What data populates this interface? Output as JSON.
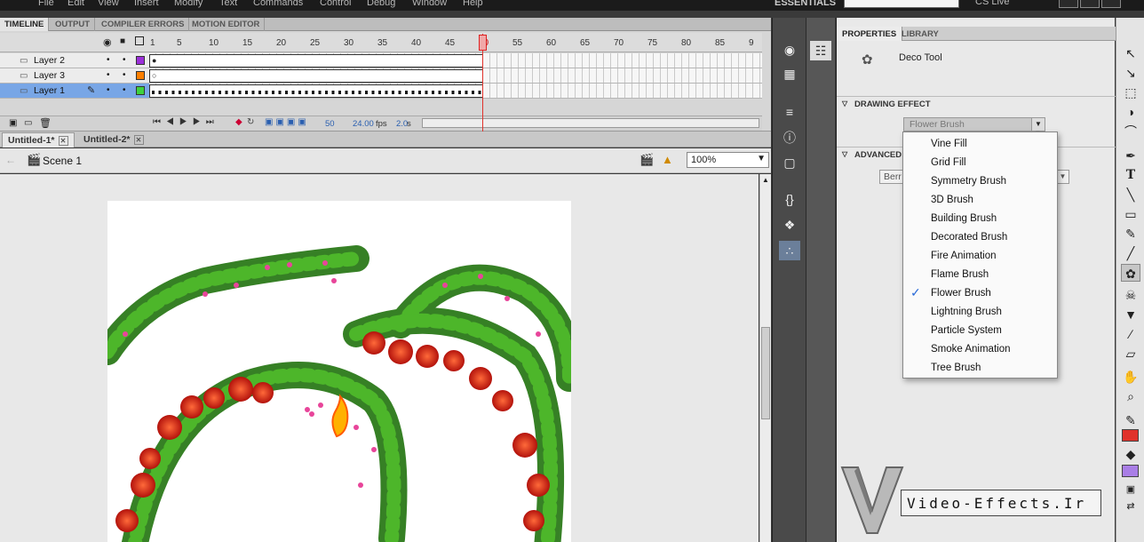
{
  "menu": [
    "File",
    "Edit",
    "View",
    "Insert",
    "Modify",
    "Text",
    "Commands",
    "Control",
    "Debug",
    "Window",
    "Help"
  ],
  "workspace": "ESSENTIALS",
  "cs_live": "CS Live",
  "timeline": {
    "tabs": [
      "TIMELINE",
      "OUTPUT",
      "COMPILER ERRORS",
      "MOTION EDITOR"
    ],
    "frame_numbers": [
      "1",
      "5",
      "10",
      "15",
      "20",
      "25",
      "30",
      "35",
      "40",
      "45",
      "50",
      "55",
      "60",
      "65",
      "70",
      "75",
      "80",
      "85",
      "9"
    ],
    "layers": [
      {
        "name": "Layer 2",
        "color": "#9b30d9",
        "selected": false
      },
      {
        "name": "Layer 3",
        "color": "#ff7f00",
        "selected": false
      },
      {
        "name": "Layer 1",
        "color": "#3ed13e",
        "selected": true
      }
    ],
    "current_frame": "50",
    "fps": "24.00",
    "fps_unit": "fps",
    "elapsed": "2.0",
    "elapsed_unit": "s"
  },
  "doc_tabs": [
    "Untitled-1*",
    "Untitled-2*"
  ],
  "scene": "Scene 1",
  "zoom": "100%",
  "properties": {
    "tabs": [
      "PROPERTIES",
      "LIBRARY"
    ],
    "tool_name": "Deco Tool",
    "drawing_effect_header": "DRAWING EFFECT",
    "selected_effect": "Flower Brush",
    "advanced_header": "ADVANCED",
    "advanced_value": "Berr"
  },
  "dropdown": {
    "items": [
      "Vine Fill",
      "Grid Fill",
      "Symmetry Brush",
      "3D Brush",
      "Building Brush",
      "Decorated Brush",
      "Fire Animation",
      "Flame Brush",
      "Flower Brush",
      "Lightning Brush",
      "Particle System",
      "Smoke Animation",
      "Tree Brush"
    ],
    "checked": "Flower Brush"
  },
  "watermark": "Video-Effects.Ir",
  "colors": {
    "stroke": "#e0322b",
    "fill": "#a97ee6",
    "selection_blue": "#78a6e6"
  }
}
